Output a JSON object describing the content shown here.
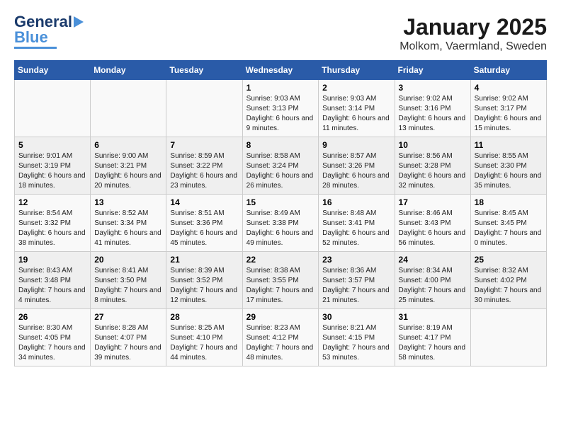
{
  "header": {
    "logo_line1": "General",
    "logo_line2": "Blue",
    "title": "January 2025",
    "subtitle": "Molkom, Vaermland, Sweden"
  },
  "days_of_week": [
    "Sunday",
    "Monday",
    "Tuesday",
    "Wednesday",
    "Thursday",
    "Friday",
    "Saturday"
  ],
  "weeks": [
    [
      {
        "day": "",
        "info": ""
      },
      {
        "day": "",
        "info": ""
      },
      {
        "day": "",
        "info": ""
      },
      {
        "day": "1",
        "info": "Sunrise: 9:03 AM\nSunset: 3:13 PM\nDaylight: 6 hours\nand 9 minutes."
      },
      {
        "day": "2",
        "info": "Sunrise: 9:03 AM\nSunset: 3:14 PM\nDaylight: 6 hours\nand 11 minutes."
      },
      {
        "day": "3",
        "info": "Sunrise: 9:02 AM\nSunset: 3:16 PM\nDaylight: 6 hours\nand 13 minutes."
      },
      {
        "day": "4",
        "info": "Sunrise: 9:02 AM\nSunset: 3:17 PM\nDaylight: 6 hours\nand 15 minutes."
      }
    ],
    [
      {
        "day": "5",
        "info": "Sunrise: 9:01 AM\nSunset: 3:19 PM\nDaylight: 6 hours\nand 18 minutes."
      },
      {
        "day": "6",
        "info": "Sunrise: 9:00 AM\nSunset: 3:21 PM\nDaylight: 6 hours\nand 20 minutes."
      },
      {
        "day": "7",
        "info": "Sunrise: 8:59 AM\nSunset: 3:22 PM\nDaylight: 6 hours\nand 23 minutes."
      },
      {
        "day": "8",
        "info": "Sunrise: 8:58 AM\nSunset: 3:24 PM\nDaylight: 6 hours\nand 26 minutes."
      },
      {
        "day": "9",
        "info": "Sunrise: 8:57 AM\nSunset: 3:26 PM\nDaylight: 6 hours\nand 28 minutes."
      },
      {
        "day": "10",
        "info": "Sunrise: 8:56 AM\nSunset: 3:28 PM\nDaylight: 6 hours\nand 32 minutes."
      },
      {
        "day": "11",
        "info": "Sunrise: 8:55 AM\nSunset: 3:30 PM\nDaylight: 6 hours\nand 35 minutes."
      }
    ],
    [
      {
        "day": "12",
        "info": "Sunrise: 8:54 AM\nSunset: 3:32 PM\nDaylight: 6 hours\nand 38 minutes."
      },
      {
        "day": "13",
        "info": "Sunrise: 8:52 AM\nSunset: 3:34 PM\nDaylight: 6 hours\nand 41 minutes."
      },
      {
        "day": "14",
        "info": "Sunrise: 8:51 AM\nSunset: 3:36 PM\nDaylight: 6 hours\nand 45 minutes."
      },
      {
        "day": "15",
        "info": "Sunrise: 8:49 AM\nSunset: 3:38 PM\nDaylight: 6 hours\nand 49 minutes."
      },
      {
        "day": "16",
        "info": "Sunrise: 8:48 AM\nSunset: 3:41 PM\nDaylight: 6 hours\nand 52 minutes."
      },
      {
        "day": "17",
        "info": "Sunrise: 8:46 AM\nSunset: 3:43 PM\nDaylight: 6 hours\nand 56 minutes."
      },
      {
        "day": "18",
        "info": "Sunrise: 8:45 AM\nSunset: 3:45 PM\nDaylight: 7 hours\nand 0 minutes."
      }
    ],
    [
      {
        "day": "19",
        "info": "Sunrise: 8:43 AM\nSunset: 3:48 PM\nDaylight: 7 hours\nand 4 minutes."
      },
      {
        "day": "20",
        "info": "Sunrise: 8:41 AM\nSunset: 3:50 PM\nDaylight: 7 hours\nand 8 minutes."
      },
      {
        "day": "21",
        "info": "Sunrise: 8:39 AM\nSunset: 3:52 PM\nDaylight: 7 hours\nand 12 minutes."
      },
      {
        "day": "22",
        "info": "Sunrise: 8:38 AM\nSunset: 3:55 PM\nDaylight: 7 hours\nand 17 minutes."
      },
      {
        "day": "23",
        "info": "Sunrise: 8:36 AM\nSunset: 3:57 PM\nDaylight: 7 hours\nand 21 minutes."
      },
      {
        "day": "24",
        "info": "Sunrise: 8:34 AM\nSunset: 4:00 PM\nDaylight: 7 hours\nand 25 minutes."
      },
      {
        "day": "25",
        "info": "Sunrise: 8:32 AM\nSunset: 4:02 PM\nDaylight: 7 hours\nand 30 minutes."
      }
    ],
    [
      {
        "day": "26",
        "info": "Sunrise: 8:30 AM\nSunset: 4:05 PM\nDaylight: 7 hours\nand 34 minutes."
      },
      {
        "day": "27",
        "info": "Sunrise: 8:28 AM\nSunset: 4:07 PM\nDaylight: 7 hours\nand 39 minutes."
      },
      {
        "day": "28",
        "info": "Sunrise: 8:25 AM\nSunset: 4:10 PM\nDaylight: 7 hours\nand 44 minutes."
      },
      {
        "day": "29",
        "info": "Sunrise: 8:23 AM\nSunset: 4:12 PM\nDaylight: 7 hours\nand 48 minutes."
      },
      {
        "day": "30",
        "info": "Sunrise: 8:21 AM\nSunset: 4:15 PM\nDaylight: 7 hours\nand 53 minutes."
      },
      {
        "day": "31",
        "info": "Sunrise: 8:19 AM\nSunset: 4:17 PM\nDaylight: 7 hours\nand 58 minutes."
      },
      {
        "day": "",
        "info": ""
      }
    ]
  ]
}
